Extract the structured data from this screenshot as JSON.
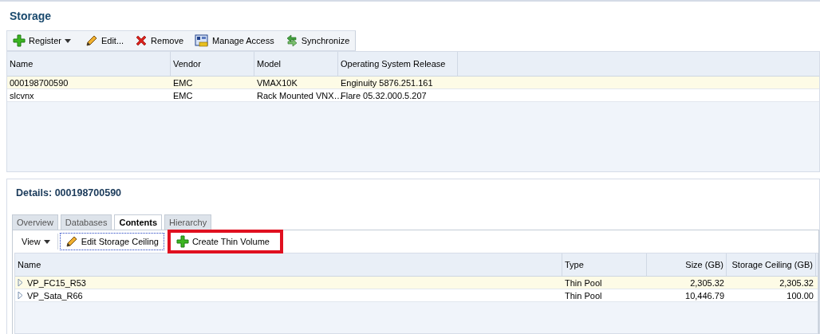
{
  "page_title": "Storage",
  "toolbar": [
    {
      "label": "Register",
      "dropdown": true
    },
    {
      "label": "Edit...",
      "dropdown": false
    },
    {
      "label": "Remove",
      "dropdown": false
    },
    {
      "label": "Manage Access",
      "dropdown": false
    },
    {
      "label": "Synchronize",
      "dropdown": false
    }
  ],
  "storage_table": {
    "columns": [
      "Name",
      "Vendor",
      "Model",
      "Operating System Release"
    ],
    "rows": [
      {
        "cells": [
          "000198700590",
          "EMC",
          "VMAX10K",
          "Enginuity 5876.251.161"
        ],
        "selected": true
      },
      {
        "cells": [
          "slcvnx",
          "EMC",
          "Rack Mounted VNX…",
          "Flare 05.32.000.5.207"
        ],
        "selected": false
      }
    ]
  },
  "details": {
    "title": "Details: 000198700590",
    "tabs": [
      {
        "label": "Overview",
        "selected": false
      },
      {
        "label": "Databases",
        "selected": false
      },
      {
        "label": "Contents",
        "selected": true
      },
      {
        "label": "Hierarchy",
        "selected": false
      }
    ],
    "toolbar": [
      {
        "label": "View",
        "dropdown": true,
        "focused": false,
        "highlighted": false
      },
      {
        "label": "Edit Storage Ceiling",
        "dropdown": false,
        "focused": true,
        "highlighted": false
      },
      {
        "label": "Create Thin Volume",
        "dropdown": false,
        "focused": false,
        "highlighted": true
      }
    ],
    "columns": [
      "Name",
      "Type",
      "Size (GB)",
      "Storage Ceiling (GB)"
    ],
    "rows": [
      {
        "cells": [
          "VP_FC15_R53",
          "Thin Pool",
          "2,305.32",
          "2,305.32"
        ],
        "selected": true,
        "expanded": false
      },
      {
        "cells": [
          "VP_Sata_R66",
          "Thin Pool",
          "10,446.79",
          "100.00"
        ],
        "selected": false,
        "expanded": false
      }
    ]
  }
}
